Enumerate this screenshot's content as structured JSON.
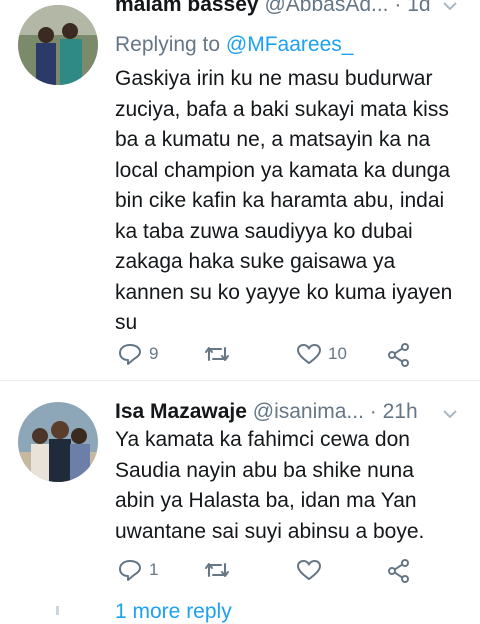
{
  "tweets": [
    {
      "name": "malam bassey",
      "handle": "@AbbasAd...",
      "dot": "·",
      "time": "1d",
      "reply_prefix": "Replying to",
      "reply_to": "@MFaarees_",
      "text": "Gaskiya irin ku ne masu budurwar zuciya, bafa a baki sukayi mata kiss ba a kumatu ne, a matsayin ka na local champion ya kamata ka dunga bin cike kafin ka haramta abu, indai ka taba zuwa saudiyya ko dubai zakaga haka suke gaisawa ya kannen su ko yayye ko kuma iyayen su",
      "replies": "9",
      "retweets": "",
      "likes": "10"
    },
    {
      "name": "Isa Mazawaje",
      "handle": "@isanima...",
      "dot": "·",
      "time": "21h",
      "text": "Ya kamata ka fahimci cewa don Saudia nayin abu ba shike nuna abin ya Halasta ba, idan ma Yan uwantane sai suyi abinsu a boye.",
      "replies": "1",
      "retweets": "",
      "likes": ""
    }
  ],
  "more_replies": "1 more reply",
  "icons": {
    "reply": "reply-icon",
    "retweet": "retweet-icon",
    "like": "heart-icon",
    "share": "share-icon",
    "menu": "chevron-down-icon"
  },
  "colors": {
    "accent": "#1da1f2",
    "muted": "#657786",
    "text": "#14171a"
  }
}
